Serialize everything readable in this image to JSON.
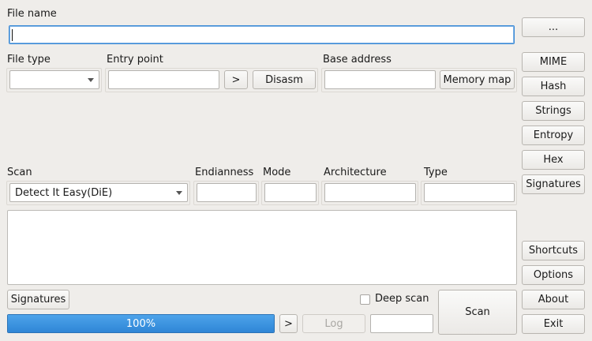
{
  "file": {
    "label": "File name",
    "value": ""
  },
  "browse_button": "...",
  "file_type": {
    "label": "File type",
    "selected": ""
  },
  "entry_point": {
    "label": "Entry point",
    "value": "",
    "go_button": ">",
    "disasm_button": "Disasm"
  },
  "base_address": {
    "label": "Base address",
    "value": "",
    "memory_map_button": "Memory map"
  },
  "side_buttons": {
    "mime": "MIME",
    "hash": "Hash",
    "strings": "Strings",
    "entropy": "Entropy",
    "hex": "Hex",
    "signatures": "Signatures",
    "shortcuts": "Shortcuts",
    "options": "Options",
    "about": "About",
    "exit": "Exit"
  },
  "scan": {
    "label": "Scan",
    "selected": "Detect It Easy(DiE)"
  },
  "endianness": {
    "label": "Endianness",
    "value": ""
  },
  "mode": {
    "label": "Mode",
    "value": ""
  },
  "architecture": {
    "label": "Architecture",
    "value": ""
  },
  "type": {
    "label": "Type",
    "value": ""
  },
  "results": {
    "text": ""
  },
  "bottom": {
    "signatures_button": "Signatures",
    "deep_scan_label": "Deep scan",
    "deep_scan_checked": false,
    "scan_button": "Scan",
    "progress": {
      "percent": 100,
      "text": "100%"
    },
    "more_button": ">",
    "log_button": "Log",
    "time_value": ""
  },
  "colors": {
    "progress": "#3a93de",
    "focus": "#3a8ad6"
  }
}
